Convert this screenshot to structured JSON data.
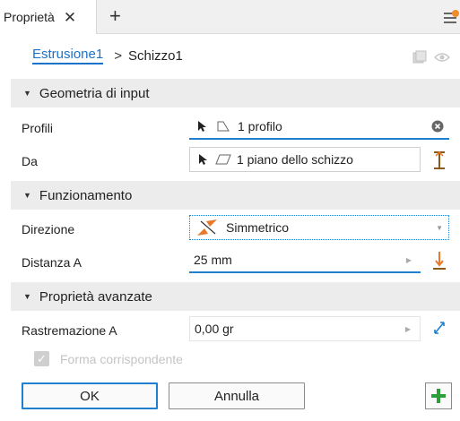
{
  "tab": {
    "title": "Proprietà",
    "close_icon": "close-icon",
    "add_icon": "plus-icon"
  },
  "breadcrumb": {
    "parent": "Estrusione1",
    "separator": ">",
    "current": "Schizzo1"
  },
  "sections": {
    "input": "Geometria di input",
    "behavior": "Funzionamento",
    "advanced": "Proprietà avanzate"
  },
  "fields": {
    "profiles_label": "Profili",
    "profiles_value": "1 profilo",
    "from_label": "Da",
    "from_value": "1 piano dello schizzo",
    "direction_label": "Direzione",
    "direction_value": "Simmetrico",
    "distance_label": "Distanza A",
    "distance_value": "25 mm",
    "taper_label": "Rastremazione A",
    "taper_value": "0,00 gr",
    "match_shape_label": "Forma corrispondente"
  },
  "buttons": {
    "ok": "OK",
    "cancel": "Annulla"
  },
  "colors": {
    "accent": "#1f7fcf",
    "link": "#1a73c8",
    "add": "#2e9e3a",
    "orange": "#e8782a"
  }
}
